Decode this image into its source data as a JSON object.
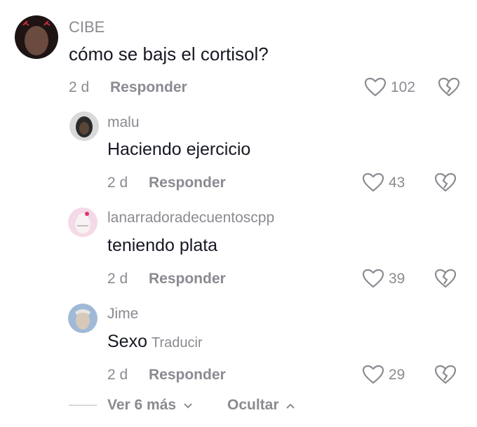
{
  "main_comment": {
    "username": "CIBE",
    "text": "cómo se bajs el cortisol?",
    "time": "2 d",
    "reply_label": "Responder",
    "likes": "102"
  },
  "replies": [
    {
      "username": "malu",
      "text": "Haciendo ejercicio",
      "time": "2 d",
      "reply_label": "Responder",
      "likes": "43"
    },
    {
      "username": "lanarradoradecuentoscpp",
      "text": "teniendo plata",
      "time": "2 d",
      "reply_label": "Responder",
      "likes": "39"
    },
    {
      "username": "Jime",
      "text": "Sexo",
      "translate_label": "Traducir",
      "time": "2 d",
      "reply_label": "Responder",
      "likes": "29"
    }
  ],
  "footer": {
    "view_more": "Ver 6 más",
    "hide": "Ocultar"
  },
  "icons": {
    "like": "heart-outline-icon",
    "dislike": "broken-heart-icon",
    "expand": "chevron-down-icon",
    "collapse": "chevron-up-icon"
  }
}
